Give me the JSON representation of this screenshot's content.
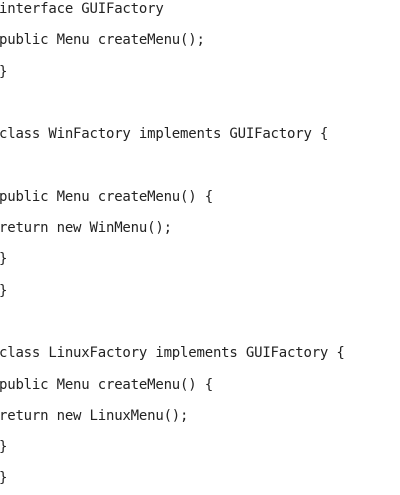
{
  "code": {
    "lines": [
      "interface GUIFactory",
      "public Menu createMenu();",
      "}",
      "",
      "class WinFactory implements GUIFactory {",
      "",
      "public Menu createMenu() {",
      "return new WinMenu();",
      "}",
      "}",
      "",
      "class LinuxFactory implements GUIFactory {",
      "public Menu createMenu() {",
      "return new LinuxMenu();",
      "}",
      "}"
    ]
  }
}
